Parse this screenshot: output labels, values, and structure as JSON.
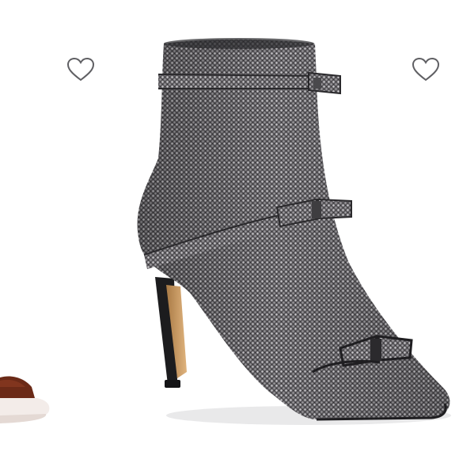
{
  "carousel": {
    "left_product": {
      "icon": "heart-outline-icon",
      "colors": {
        "leather": "#6b2a17",
        "sole": "#f3ece9"
      }
    },
    "main_product": {
      "icon": "heart-outline-icon",
      "colors": {
        "upper_dark": "#3c3b3d",
        "upper_mid": "#7d7b7e",
        "upper_light": "#c9c8ca",
        "heel_lining": "#c99b63",
        "heel": "#1c1c1e"
      }
    }
  }
}
